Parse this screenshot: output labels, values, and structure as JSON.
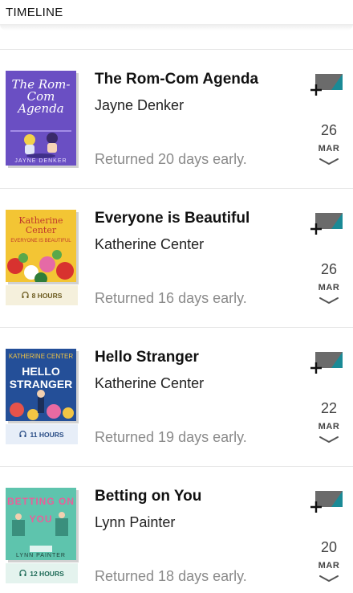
{
  "header": {
    "title": "TIMELINE"
  },
  "books": [
    {
      "title": "The Rom-Com Agenda",
      "author": "Jayne Denker",
      "note": "Returned 20 days early.",
      "day": "26",
      "month": "MAR",
      "cover": {
        "title": "The Rom-Com Agenda",
        "author": "JAYNE DENKER",
        "bg": "#6a4fc3",
        "accent": "#f2d14a"
      },
      "hours": null
    },
    {
      "title": "Everyone is Beautiful",
      "author": "Katherine Center",
      "note": "Returned 16 days early.",
      "day": "26",
      "month": "MAR",
      "cover": {
        "title": "Katherine Center",
        "subtitle": "EVERYONE IS BEAUTIFUL",
        "bg": "#f3c534",
        "accent": "#d8322f"
      },
      "hours": "8 HOURS",
      "hours_bg": "#f5f0dc",
      "hours_fg": "#6b5a1e"
    },
    {
      "title": "Hello Stranger",
      "author": "Katherine Center",
      "note": "Returned 19 days early.",
      "day": "22",
      "month": "MAR",
      "cover": {
        "title": "HELLO STRANGER",
        "author": "KATHERINE CENTER",
        "bg": "#244f98",
        "accent": "#f2c544"
      },
      "hours": "11 HOURS",
      "hours_bg": "#e7eef8",
      "hours_fg": "#2a4d86"
    },
    {
      "title": "Betting on You",
      "author": "Lynn Painter",
      "note": "Returned 18 days early.",
      "day": "20",
      "month": "MAR",
      "cover": {
        "title": "BETTING ON YOU",
        "author": "LYNN PAINTER",
        "bg": "#5ec4ad",
        "accent": "#e8609a"
      },
      "hours": "12 HOURS",
      "hours_bg": "#e4f3ee",
      "hours_fg": "#1f6b58"
    }
  ],
  "colors": {
    "divider": "#e7e7e7",
    "muted": "#8a8a8a",
    "icon_gray": "#6b6b6b",
    "icon_teal": "#1a8a96"
  },
  "icons": {
    "add": "add-to-shelf-icon",
    "expand": "chevron-down-icon",
    "audio": "headphones-icon"
  }
}
